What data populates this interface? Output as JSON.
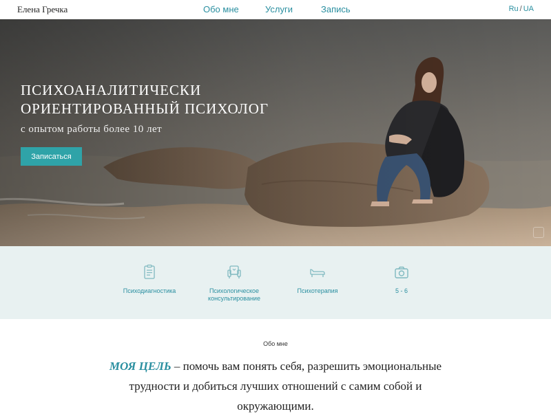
{
  "header": {
    "logo": "Елена Гречка",
    "nav": [
      {
        "label": "Обо мне"
      },
      {
        "label": "Услуги"
      },
      {
        "label": "Запись"
      }
    ],
    "lang": {
      "ru": "Ru",
      "sep": "/",
      "ua": "UA"
    }
  },
  "hero": {
    "title_line1": "ПСИХОАНАЛИТИЧЕСКИ",
    "title_line2": "ОРИЕНТИРОВАННЫЙ ПСИХОЛОГ",
    "subtitle": "с опытом работы более 10 лет",
    "button": "Записаться"
  },
  "services": [
    {
      "label": "Психодиагностика",
      "icon": "clipboard-icon"
    },
    {
      "label": "Психологическое консультирование",
      "icon": "armchair-icon"
    },
    {
      "label": "Психотерапия",
      "icon": "couch-icon"
    },
    {
      "label": "5 - 6",
      "icon": "camera-icon"
    }
  ],
  "about": {
    "section_label": "Обо мне",
    "accent": "МОЯ ЦЕЛЬ",
    "text": " – помочь вам понять себя, разрешить эмоциональные трудности и добиться лучших отношений с самим собой и окружающими."
  },
  "colors": {
    "accent": "#2a8fa0",
    "button": "#2fa3a8",
    "services_bg": "#e8f1f1"
  }
}
